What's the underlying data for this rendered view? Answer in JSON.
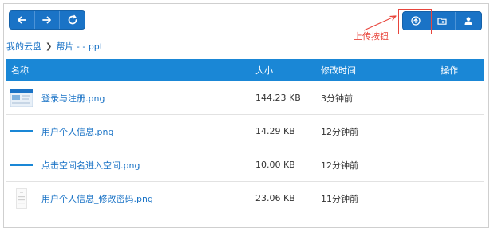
{
  "toolbar": {
    "back_icon": "arrow-left-icon",
    "forward_icon": "arrow-right-icon",
    "refresh_icon": "refresh-icon",
    "upload_icon": "upload-icon",
    "new_folder_icon": "folder-add-icon",
    "share_icon": "user-icon"
  },
  "annotation": {
    "label": "上传按钮"
  },
  "breadcrumb": {
    "root": "我的云盘",
    "current": "帮片 - - ppt"
  },
  "table": {
    "headers": {
      "name": "名称",
      "size": "大小",
      "time": "修改时间",
      "action": "操作"
    },
    "rows": [
      {
        "name": "登录与注册.png",
        "size": "144.23 KB",
        "time": "3分钟前"
      },
      {
        "name": "用户个人信息.png",
        "size": "14.29 KB",
        "time": "12分钟前"
      },
      {
        "name": "点击空间名进入空间.png",
        "size": "10.00 KB",
        "time": "12分钟前"
      },
      {
        "name": "用户个人信息_修改密码.png",
        "size": "23.06 KB",
        "time": "11分钟前"
      }
    ]
  },
  "colors": {
    "accent": "#1a73c6",
    "header_bg": "#1a87d6",
    "annotation": "#e8453c"
  }
}
